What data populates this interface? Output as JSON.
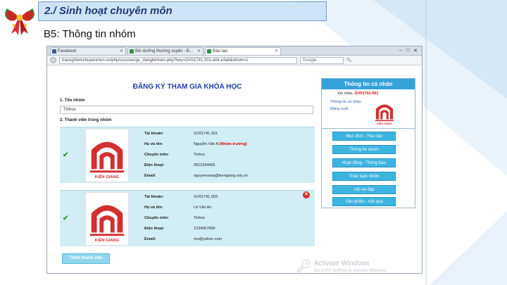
{
  "slide": {
    "title": "2./ Sinh hoạt chuyên môn",
    "subtitle": "B5: Thông tin nhóm"
  },
  "browser": {
    "tabs": [
      {
        "label": "Facebook",
        "active": false
      },
      {
        "label": "Bồi dưỡng thường xuyên - Đ...",
        "active": false
      },
      {
        "label": "Đào tạo",
        "active": true
      }
    ],
    "url": "tracnghiemchuyenmon.vn/php/courses/gv_dangkinhom.php?key=GV01741.001.a04.e3ab&nhom=1",
    "search_placeholder": "Google"
  },
  "form": {
    "title": "ĐĂNG KÝ THAM GIA KHÓA HỌC",
    "group_name_label": "1. Tên nhóm",
    "group_name_value": "Tinhoc",
    "members_label": "2. Thành viên trong nhóm",
    "submit_label": "Thêm thành viên"
  },
  "members": [
    {
      "account_label": "Tài khoản:",
      "account": "GV01741.001",
      "name_label": "Họ và tên:",
      "name": "Nguyễn Văn A",
      "role": "(Nhóm trưởng)",
      "major_label": "Chuyên môn:",
      "major": "Tinhoc",
      "phone_label": "Điện thoại:",
      "phone": "0913334455",
      "email_label": "Email:",
      "email": "nguyenvana@kiengiang.edu.vn",
      "logo_text": "KIÊN GIANG"
    },
    {
      "account_label": "Tài khoản:",
      "account": "GV01741.003",
      "name_label": "Họ và tên:",
      "name": "Lê Văn An",
      "role": "",
      "major_label": "Chuyên môn:",
      "major": "Tinhoc",
      "phone_label": "Điện thoại:",
      "phone": "1234567890",
      "email_label": "Email:",
      "email": "mu@yahoo.com",
      "logo_text": "KIÊN GIANG"
    }
  ],
  "personal_panel": {
    "header": "Thông tin cá nhân",
    "greeting": "Xin chào,",
    "user": "GV01741.001",
    "link_info": "Thông tin cá nhân",
    "link_logout": "Đăng xuất",
    "logo_text": "KIÊN GIANG"
  },
  "menu": {
    "items": [
      "Mục đích - Yêu cầu",
      "Thông tin nhóm",
      "Hoạt động - Thông báo",
      "Thảo luận nhóm",
      "Hỏi và đáp",
      "Sản phẩm - Kết quả"
    ]
  },
  "watermark": {
    "line1": "Activate Windows",
    "line2": "Go to PC settings to activate Windows."
  },
  "colors": {
    "accent": "#34a3d8",
    "member_bg": "#d2eef4",
    "title_bg": "#cfe3f6"
  }
}
